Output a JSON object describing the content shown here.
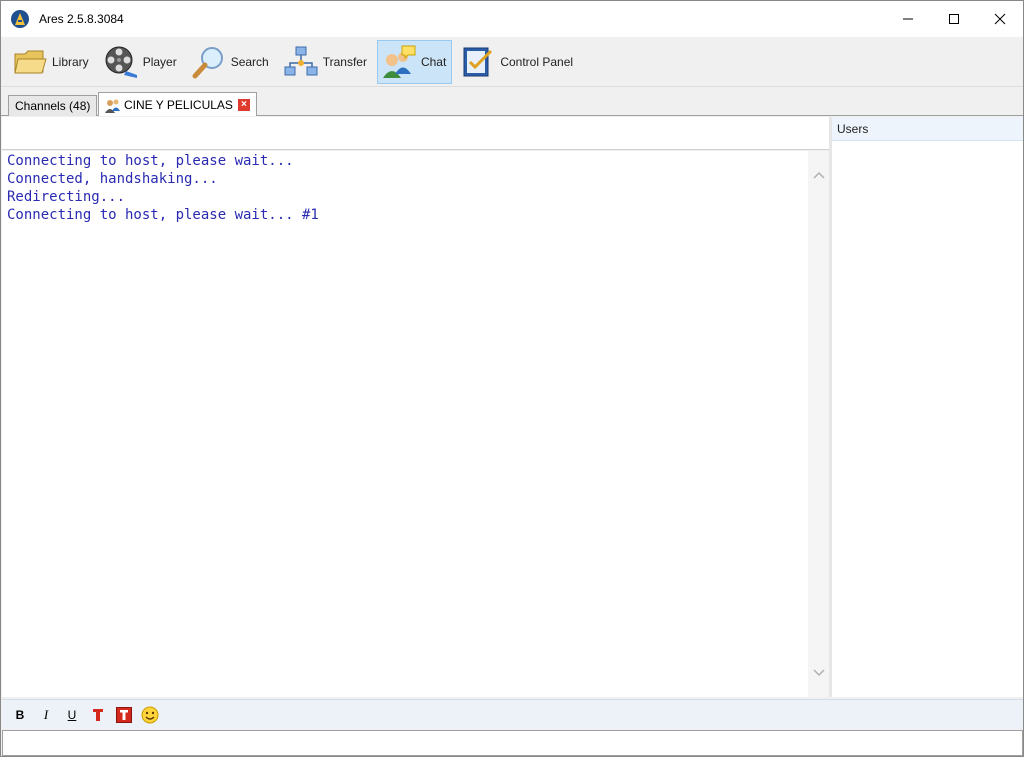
{
  "window": {
    "title": "Ares 2.5.8.3084"
  },
  "toolbar": {
    "items": [
      {
        "label": "Library",
        "icon": "folder-icon"
      },
      {
        "label": "Player",
        "icon": "film-reel-icon"
      },
      {
        "label": "Search",
        "icon": "magnifier-icon"
      },
      {
        "label": "Transfer",
        "icon": "network-icon"
      },
      {
        "label": "Chat",
        "icon": "chat-users-icon",
        "active": true
      },
      {
        "label": "Control Panel",
        "icon": "checklist-icon"
      }
    ]
  },
  "tabs": [
    {
      "label": "Channels (48)",
      "active": false
    },
    {
      "label": "CINE Y PELICULAS",
      "active": true,
      "icon": "users-icon",
      "closable": true
    }
  ],
  "chat": {
    "topic": "",
    "lines": [
      "Connecting to host, please wait...",
      "Connected, handshaking...",
      "Redirecting...",
      "Connecting to host, please wait... #1"
    ],
    "text_color": "#2a2ab3"
  },
  "users_panel": {
    "header": "Users"
  },
  "format_bar": {
    "bold": "B",
    "italic": "I",
    "underline": "U"
  },
  "input": {
    "value": ""
  },
  "colors": {
    "active_tab_bg": "#cce4f7",
    "close_red": "#e03a2e"
  }
}
